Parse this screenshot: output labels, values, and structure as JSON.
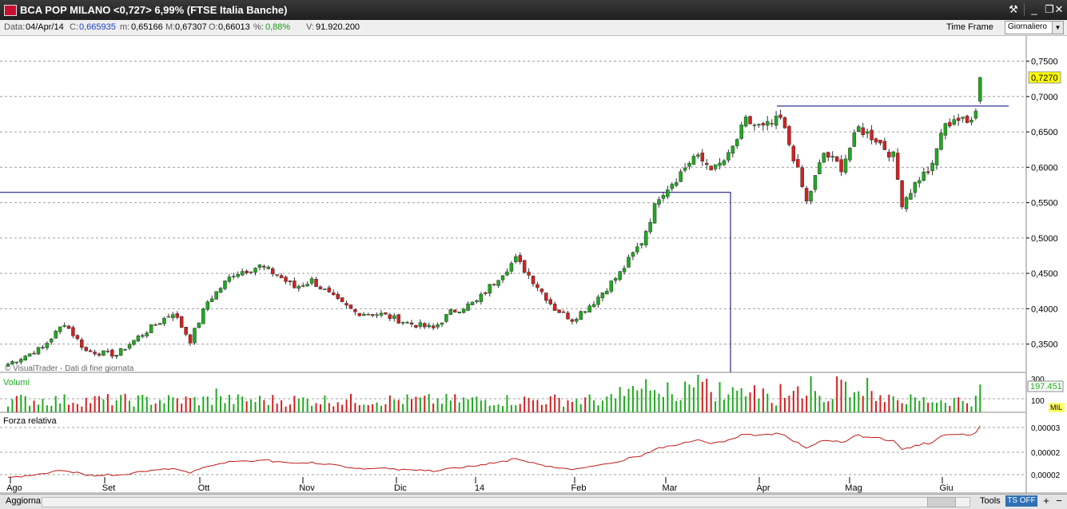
{
  "window": {
    "title": "BCA POP MILANO <0,727> 6,99%  (FTSE Italia Banche)",
    "minimize": "_",
    "restore": "❐",
    "close": "✕",
    "tool_icon": "tool-icon"
  },
  "infobar": {
    "date_label": "Data:",
    "date": "04/Apr/14",
    "close_label": "C:",
    "close": "0,665935",
    "min_label": "m:",
    "min": "0,65166",
    "max_label": "M:",
    "max": "0,67307",
    "open_label": "O:",
    "open": "0,66013",
    "pct_label": "%:",
    "pct": "0,88%",
    "vol_label": "V:",
    "vol": "91.920.200",
    "timeframe_label": "Time Frame",
    "timeframe_value": "Giornaliero"
  },
  "bottombar": {
    "refresh": "Aggiorna",
    "tools": "Tools",
    "ts": "TS OFF",
    "zoom_in": "+",
    "zoom_out": "−"
  },
  "colors": {
    "up": "#1faa1f",
    "down": "#d42020",
    "rs_line": "#c01818",
    "box": "#00007a",
    "last_price_bg": "#ffff00"
  },
  "chart_data": {
    "type": "candlestick",
    "watermark": "© VisualTrader - Dati di fine giornata",
    "price_axis": {
      "range": [
        0.31,
        0.78
      ],
      "ticks": [
        "0,3500",
        "0,4000",
        "0,4500",
        "0,5000",
        "0,5500",
        "0,6000",
        "0,6500",
        "0,7000",
        "0,7500"
      ]
    },
    "last_price": "0,7270",
    "x_labels": [
      "Ago",
      "Set",
      "Ott",
      "Nov",
      "Dic",
      "14",
      "Feb",
      "Mar",
      "Apr",
      "Mag",
      "Giu"
    ],
    "price_waypoints": [
      [
        0,
        0.322
      ],
      [
        8,
        0.345
      ],
      [
        13,
        0.38
      ],
      [
        18,
        0.34
      ],
      [
        25,
        0.335
      ],
      [
        30,
        0.36
      ],
      [
        38,
        0.395
      ],
      [
        42,
        0.355
      ],
      [
        46,
        0.41
      ],
      [
        52,
        0.45
      ],
      [
        58,
        0.46
      ],
      [
        62,
        0.448
      ],
      [
        66,
        0.43
      ],
      [
        70,
        0.44
      ],
      [
        76,
        0.41
      ],
      [
        80,
        0.395
      ],
      [
        86,
        0.392
      ],
      [
        92,
        0.38
      ],
      [
        98,
        0.372
      ],
      [
        102,
        0.395
      ],
      [
        108,
        0.41
      ],
      [
        113,
        0.445
      ],
      [
        117,
        0.47
      ],
      [
        121,
        0.44
      ],
      [
        126,
        0.4
      ],
      [
        130,
        0.385
      ],
      [
        135,
        0.41
      ],
      [
        141,
        0.45
      ],
      [
        146,
        0.495
      ],
      [
        150,
        0.56
      ],
      [
        154,
        0.585
      ],
      [
        158,
        0.615
      ],
      [
        163,
        0.598
      ],
      [
        166,
        0.615
      ],
      [
        170,
        0.665
      ],
      [
        174,
        0.655
      ],
      [
        178,
        0.668
      ],
      [
        181,
        0.615
      ],
      [
        184,
        0.55
      ],
      [
        188,
        0.62
      ],
      [
        192,
        0.6
      ],
      [
        196,
        0.655
      ],
      [
        200,
        0.64
      ],
      [
        204,
        0.615
      ],
      [
        206,
        0.55
      ],
      [
        210,
        0.585
      ],
      [
        213,
        0.6
      ],
      [
        215,
        0.65
      ],
      [
        218,
        0.67
      ],
      [
        221,
        0.662
      ],
      [
        223,
        0.685
      ],
      [
        224,
        0.727
      ]
    ],
    "volume": {
      "label": "Volumi",
      "ticks": [
        "300",
        "100"
      ],
      "last_value": "197.451",
      "unit": "MIL"
    },
    "relative_strength": {
      "label": "Forza relativa",
      "ticks": [
        "0,00003",
        "0,00002",
        "0,00002"
      ]
    },
    "lines": {
      "box_level": 0.5645,
      "resistance_level": 0.6865
    }
  }
}
